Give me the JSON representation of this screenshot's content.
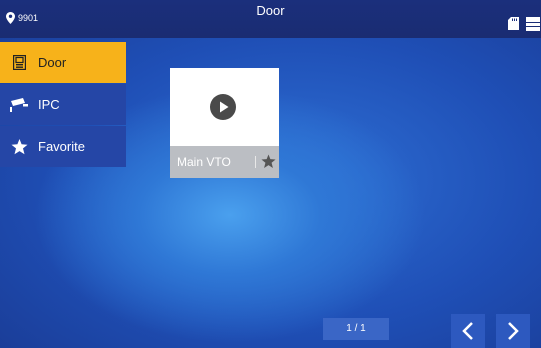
{
  "header": {
    "room_number": "9901",
    "title": "Door"
  },
  "sidebar": {
    "items": [
      {
        "label": "Door",
        "icon": "door-station-icon",
        "active": true
      },
      {
        "label": "IPC",
        "icon": "camera-icon",
        "active": false
      },
      {
        "label": "Favorite",
        "icon": "star-icon",
        "active": false
      }
    ]
  },
  "device_card": {
    "name": "Main VTO"
  },
  "pagination": {
    "text": "1 / 1"
  },
  "colors": {
    "accent": "#f7b21a",
    "topbar": "#1b2f7c",
    "sidebar_item": "#2546a6"
  }
}
